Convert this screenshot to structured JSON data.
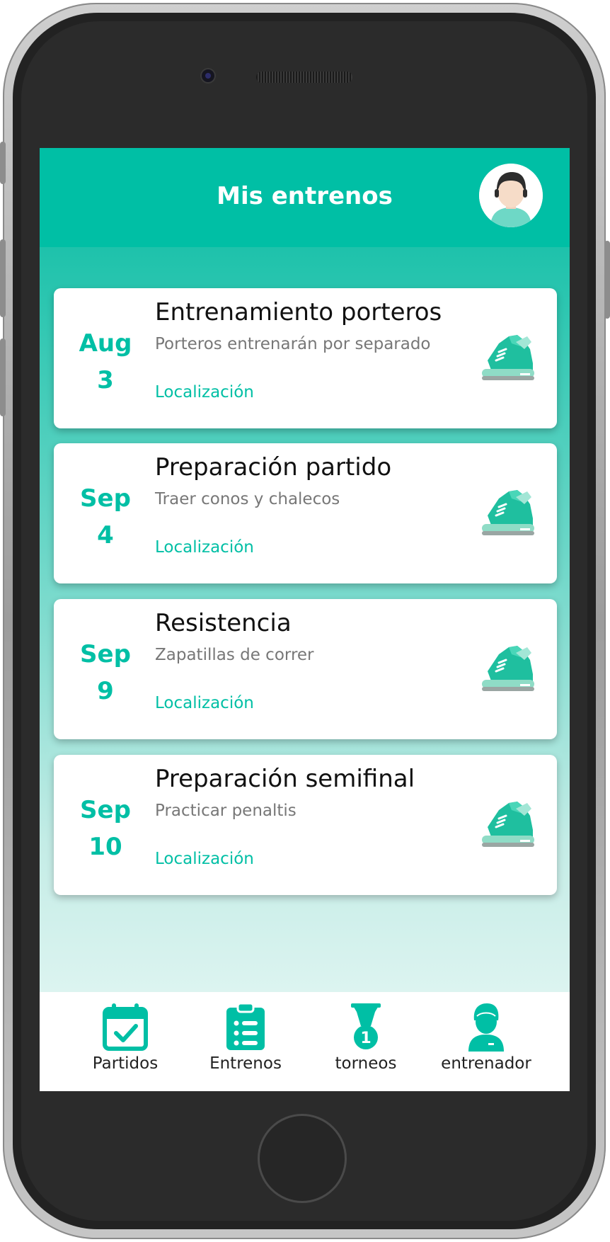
{
  "app": {
    "title": "Mis entrenos",
    "accent_color": "#00bfa5"
  },
  "header": {
    "avatar_icon": "user-avatar-icon"
  },
  "trainings": [
    {
      "month": "Aug",
      "day": "3",
      "title": "Entrenamiento porteros",
      "description": "Porteros entrenarán por separado",
      "location_label": "Localización",
      "icon": "sneaker-icon"
    },
    {
      "month": "Sep",
      "day": "4",
      "title": "Preparación partido",
      "description": "Traer conos y chalecos",
      "location_label": "Localización",
      "icon": "sneaker-icon"
    },
    {
      "month": "Sep",
      "day": "9",
      "title": "Resistencia",
      "description": "Zapatillas de correr",
      "location_label": "Localización",
      "icon": "sneaker-icon"
    },
    {
      "month": "Sep",
      "day": "10",
      "title": "Preparación semifinal",
      "description": "Practicar penaltis",
      "location_label": "Localización",
      "icon": "sneaker-icon"
    }
  ],
  "bottom_nav": {
    "items": [
      {
        "label": "Partidos",
        "icon": "calendar-check-icon"
      },
      {
        "label": "Entrenos",
        "icon": "clipboard-list-icon"
      },
      {
        "label": "torneos",
        "icon": "medal-icon"
      },
      {
        "label": "entrenador",
        "icon": "coach-icon"
      }
    ]
  }
}
